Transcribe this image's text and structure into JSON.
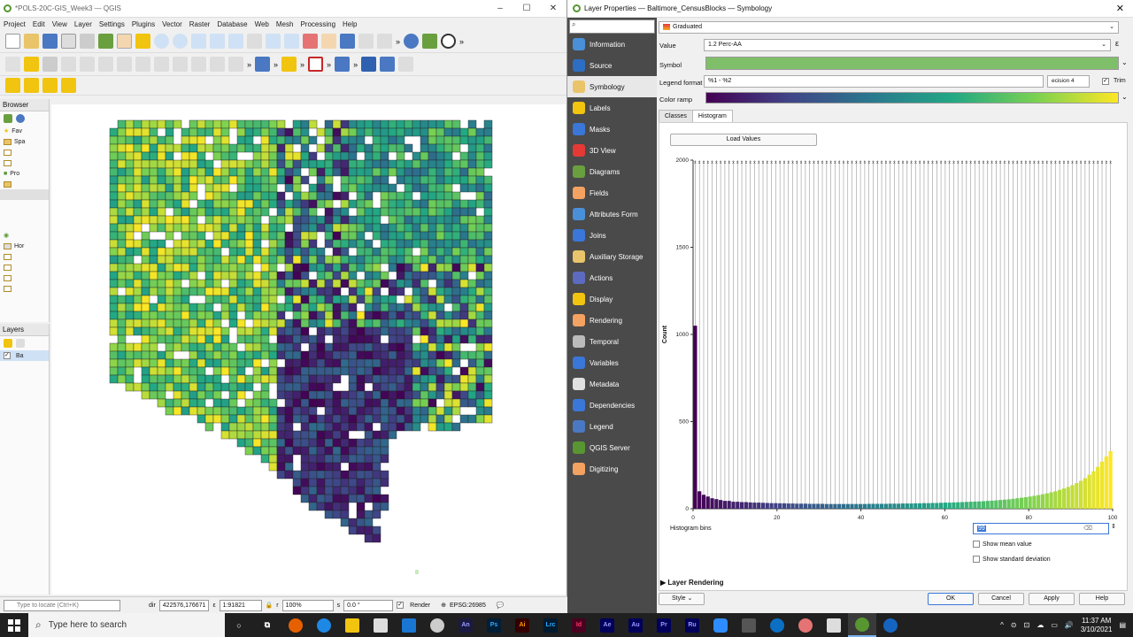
{
  "qgis": {
    "title": "*POLS-20C-GIS_Week3 — QGIS",
    "menu": [
      "Project",
      "Edit",
      "View",
      "Layer",
      "Settings",
      "Plugins",
      "Vector",
      "Raster",
      "Database",
      "Web",
      "Mesh",
      "Processing",
      "Help"
    ],
    "browser_title": "Browser",
    "browser_items": [
      "Fav",
      "Spa",
      "Pro",
      "Hor"
    ],
    "layers_title": "Layers",
    "layer_item": "Ba",
    "status": {
      "locate_placeholder": "Type to locate (Ctrl+K)",
      "coord_label": "dir",
      "coord_value": "422576,176671",
      "scale_label": "1:91821",
      "magnifier_label": "r",
      "magnifier_value": "100%",
      "rotation_label": "s",
      "rotation_value": "0.0 °",
      "render_label": "Render",
      "crs": "EPSG:26985"
    },
    "map_marker": "8"
  },
  "dialog": {
    "title": "Layer Properties — Baltimore_CensusBlocks — Symbology",
    "sidebar": [
      "Information",
      "Source",
      "Symbology",
      "Labels",
      "Masks",
      "3D View",
      "Diagrams",
      "Fields",
      "Attributes Form",
      "Joins",
      "Auxiliary Storage",
      "Actions",
      "Display",
      "Rendering",
      "Temporal",
      "Variables",
      "Metadata",
      "Dependencies",
      "Legend",
      "QGIS Server",
      "Digitizing"
    ],
    "sidebar_active": "Symbology",
    "renderer": "Graduated",
    "value_label": "Value",
    "value": "1.2 Perc-AA",
    "symbol_label": "Symbol",
    "symbol_color": "#7fbf6a",
    "legend_format_label": "Legend format",
    "legend_format": "%1 - %2",
    "precision_label": "ecision",
    "precision_value": "4",
    "trim_label": "Trim",
    "color_ramp_label": "Color ramp",
    "tabs": [
      "Classes",
      "Histogram"
    ],
    "active_tab": "Histogram",
    "load_values": "Load Values",
    "histogram_bins_label": "Histogram bins",
    "histogram_bins_value": "99",
    "show_mean": "Show mean value",
    "show_std": "Show standard deviation",
    "layer_rendering": "Layer Rendering",
    "style_btn": "Style",
    "ok": "OK",
    "cancel": "Cancel",
    "apply": "Apply",
    "help": "Help"
  },
  "chart_data": {
    "type": "bar",
    "title": "",
    "xlabel": "",
    "ylabel": "Count",
    "xlim": [
      0,
      100
    ],
    "ylim": [
      0,
      2000
    ],
    "xticks": [
      0,
      20,
      40,
      60,
      80,
      100
    ],
    "yticks": [
      0,
      500,
      1000,
      1500,
      2000
    ],
    "grid": false,
    "legend": "none",
    "bins": 99,
    "values": [
      1050,
      100,
      80,
      70,
      60,
      55,
      50,
      45,
      45,
      40,
      40,
      38,
      38,
      36,
      35,
      35,
      34,
      33,
      32,
      32,
      31,
      31,
      30,
      30,
      29,
      29,
      29,
      28,
      28,
      28,
      28,
      27,
      27,
      27,
      27,
      27,
      27,
      27,
      27,
      27,
      27,
      28,
      28,
      28,
      28,
      28,
      29,
      29,
      29,
      30,
      30,
      30,
      31,
      31,
      32,
      32,
      33,
      33,
      34,
      35,
      35,
      36,
      37,
      38,
      39,
      40,
      41,
      42,
      43,
      45,
      46,
      48,
      50,
      52,
      54,
      57,
      60,
      63,
      66,
      70,
      74,
      78,
      83,
      88,
      94,
      100,
      108,
      116,
      125,
      135,
      147,
      160,
      175,
      195,
      215,
      240,
      270,
      300,
      330
    ]
  },
  "taskbar": {
    "search_placeholder": "Type here to search",
    "apps": [
      "An",
      "Ps",
      "Ai",
      "Lrc",
      "Id",
      "Ae",
      "Au",
      "Pr",
      "Ru"
    ],
    "time": "11:37 AM",
    "date": "3/10/2021"
  }
}
